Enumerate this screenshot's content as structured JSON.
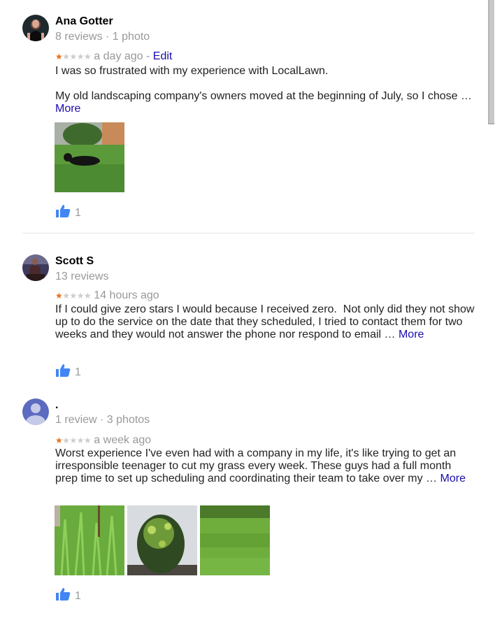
{
  "colors": {
    "star_filled": "#e7711b",
    "star_empty": "#cccccc",
    "link": "#1a0dab",
    "like_icon": "#4285f4",
    "meta_text": "#999999"
  },
  "reviews": [
    {
      "author": "Ana Gotter",
      "author_meta": "8 reviews · 1 photo",
      "avatar": "profile-photo",
      "rating": 1,
      "rating_max": 5,
      "time": "a day ago",
      "edit_separator": " - ",
      "edit_label": "Edit",
      "text": "I was so frustrated with my experience with LocalLawn.\n\nMy old landscaping company's owners moved at the beginning of July, so I chose … ",
      "more_label": "More",
      "photos": [
        "dog-in-grass-photo"
      ],
      "likes": "1"
    },
    {
      "author": "Scott S",
      "author_meta": "13 reviews",
      "avatar": "profile-photo",
      "rating": 1,
      "rating_max": 5,
      "time": "14 hours ago",
      "text": "If I could give zero stars I would because I received zero.  Not only did they not show up to do the service on the date that they scheduled, I tried to contact them for two weeks and they would not answer the phone nor respond to email … ",
      "more_label": "More",
      "photos": [],
      "likes": "1"
    },
    {
      "author": ".",
      "author_meta": "1 review · 3 photos",
      "avatar": "default-user-icon",
      "rating": 1,
      "rating_max": 5,
      "time": "a week ago",
      "text": "Worst experience I've even had with a company in my life, it's like trying to get an irresponsible teenager to cut my grass every week. These guys had a full month prep time to set up scheduling and coordinating their team to take over my … ",
      "more_label": "More",
      "photos": [
        "tall-grass-photo",
        "overgrown-shrub-photo",
        "lawn-photo"
      ],
      "likes": "1"
    }
  ]
}
